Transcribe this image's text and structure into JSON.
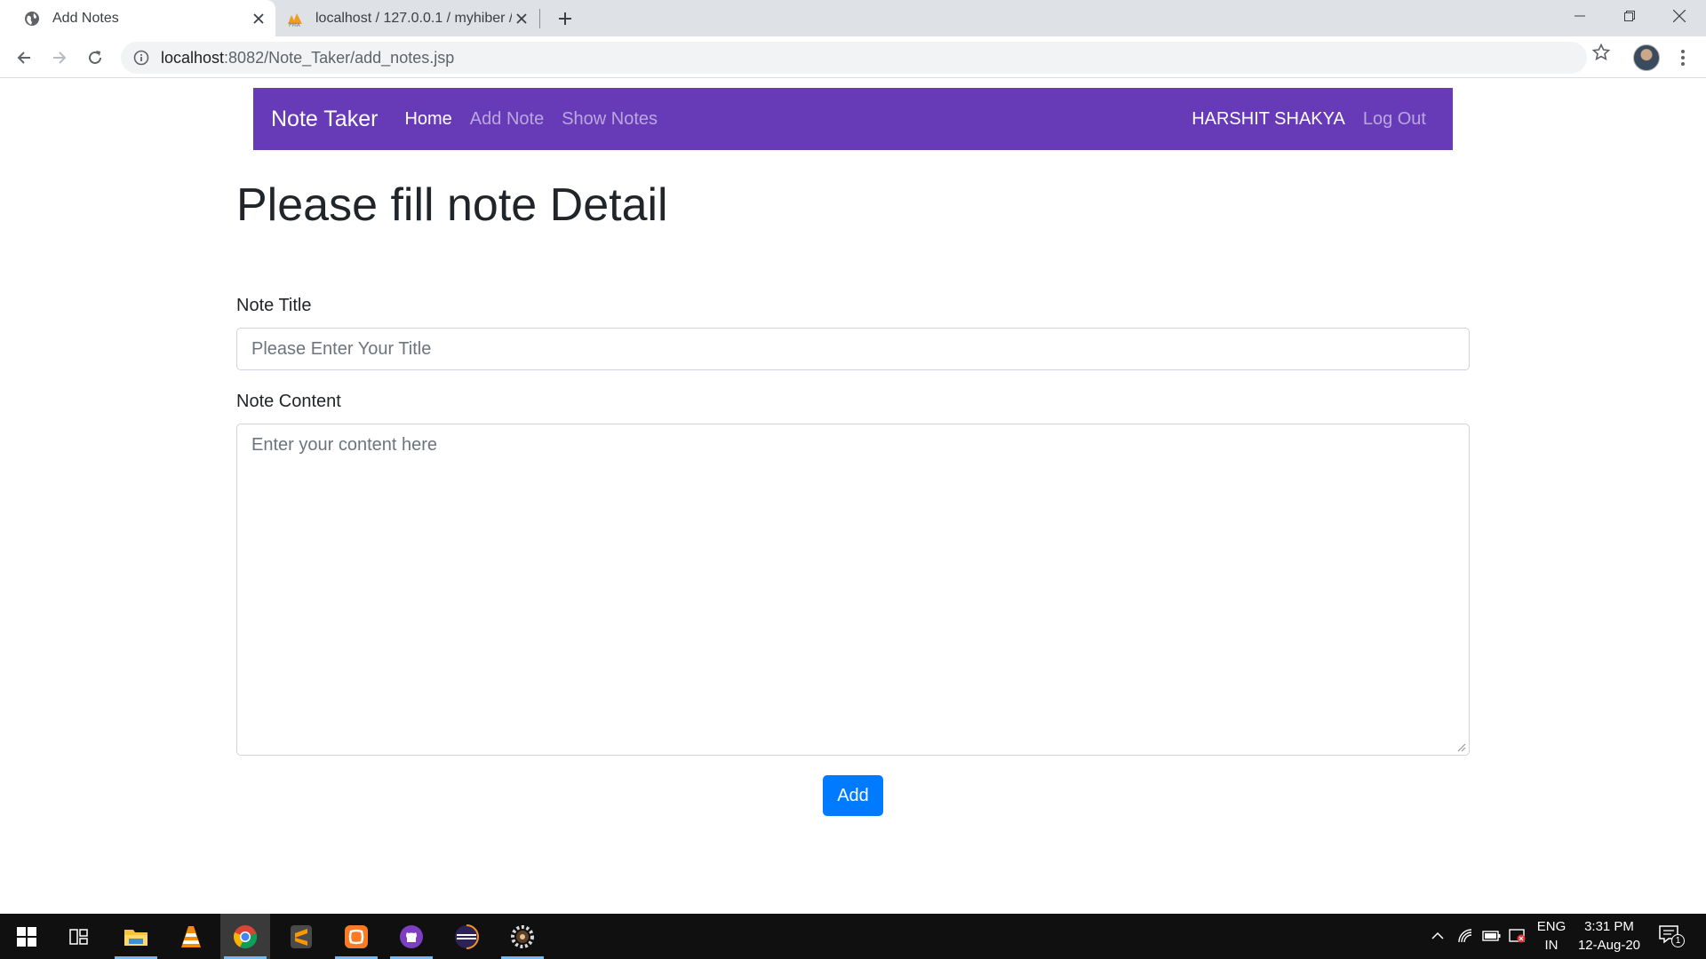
{
  "browser": {
    "tabs": [
      {
        "title": "Add Notes",
        "active": true,
        "favicon": "globe-icon"
      },
      {
        "title": "localhost / 127.0.0.1 / myhiber / r",
        "active": false,
        "favicon": "phpmyadmin-icon"
      }
    ],
    "address": {
      "host": "localhost",
      "rest": ":8082/Note_Taker/add_notes.jsp"
    }
  },
  "navbar": {
    "brand": "Note Taker",
    "links": [
      "Home",
      "Add Note",
      "Show Notes"
    ],
    "user": "HARSHIT SHAKYA",
    "logout": "Log Out",
    "color": "#673ab7"
  },
  "form": {
    "heading": "Please fill note Detail",
    "title_label": "Note Title",
    "title_placeholder": "Please Enter Your Title",
    "content_label": "Note Content",
    "content_placeholder": "Enter your content here",
    "submit_label": "Add",
    "submit_color": "#007bff"
  },
  "taskbar": {
    "apps": [
      "windows-start-icon",
      "task-view-icon",
      "file-explorer-icon",
      "vlc-icon",
      "chrome-icon",
      "sublime-text-icon",
      "xampp-icon",
      "github-desktop-icon",
      "eclipse-icon",
      "settings-app-icon"
    ],
    "lang_top": "ENG",
    "lang_bottom": "IN",
    "time": "3:31 PM",
    "date": "12-Aug-20",
    "notification_count": "1"
  }
}
